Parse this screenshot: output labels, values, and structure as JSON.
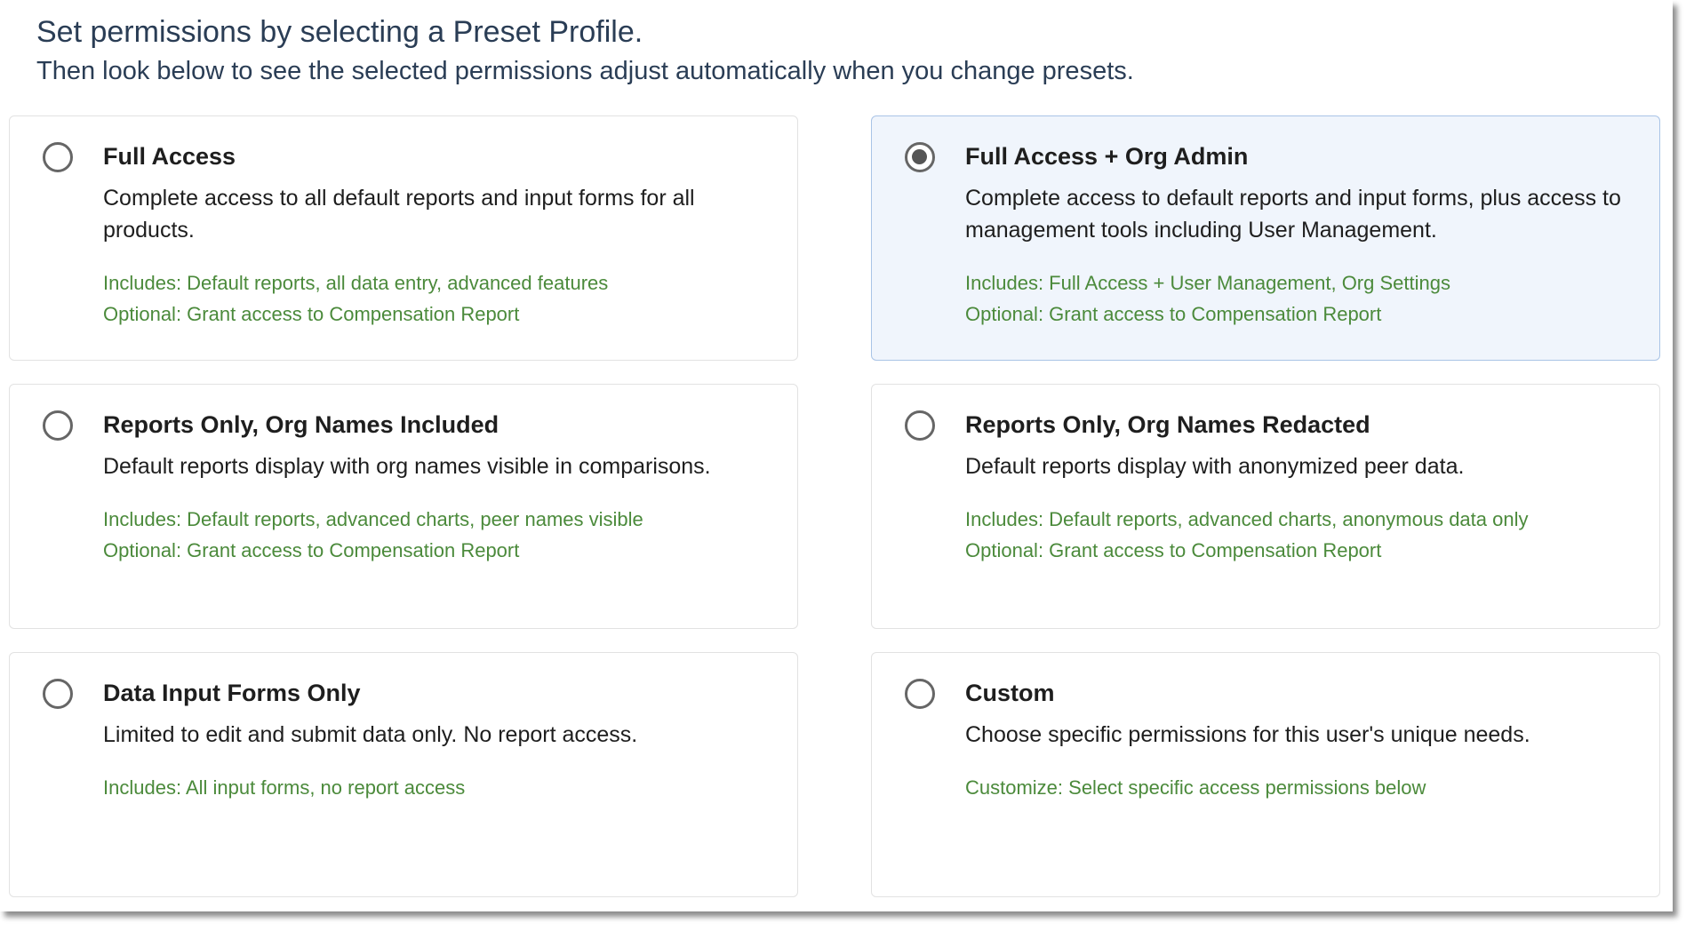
{
  "header": {
    "title": "Set permissions by selecting a Preset Profile.",
    "subtitle": "Then look below to see the selected permissions adjust automatically when you change presets."
  },
  "colors": {
    "accent_text": "#2a3d55",
    "detail_green": "#4b8a3b",
    "selected_bg": "#f0f5fc",
    "selected_border": "#a9c4e6"
  },
  "presets": [
    {
      "title": "Full Access",
      "description": "Complete access to all default reports and input forms for all products.",
      "line1": "Includes: Default reports, all data entry, advanced features",
      "line2": "Optional: Grant access to Compensation Report",
      "selected": false
    },
    {
      "title": "Full Access + Org Admin",
      "description": "Complete access to default reports and input forms, plus access to management tools including User Management.",
      "line1": "Includes: Full Access + User Management, Org Settings",
      "line2": "Optional: Grant access to Compensation Report",
      "selected": true
    },
    {
      "title": "Reports Only, Org Names Included",
      "description": "Default reports display with org names visible in comparisons.",
      "line1": "Includes: Default reports, advanced charts, peer names visible",
      "line2": "Optional: Grant access to Compensation Report",
      "selected": false
    },
    {
      "title": "Reports Only, Org Names Redacted",
      "description": "Default reports display with anonymized peer data.",
      "line1": "Includes: Default reports, advanced charts, anonymous data only",
      "line2": "Optional: Grant access to Compensation Report",
      "selected": false
    },
    {
      "title": "Data Input Forms Only",
      "description": "Limited to edit and submit data only. No report access.",
      "line1": "Includes: All input forms, no report access",
      "selected": false
    },
    {
      "title": "Custom",
      "description": "Choose specific permissions for this user's unique needs.",
      "line1": "Customize: Select specific access permissions below",
      "selected": false
    }
  ]
}
